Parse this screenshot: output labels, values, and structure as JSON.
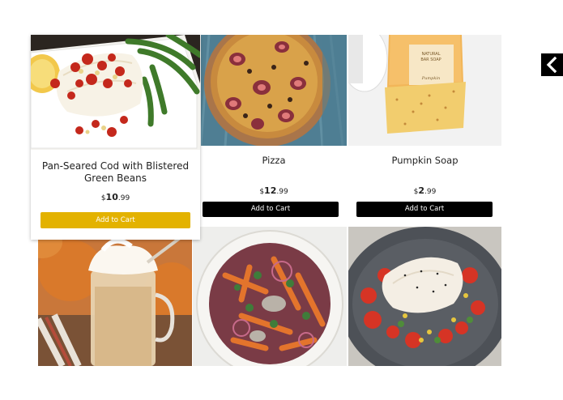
{
  "products": [
    {
      "name": "Pan-Seared Cod with Blistered Green Beans",
      "currency": "$",
      "price_whole": "10",
      "price_cents": ".99",
      "button": "Add to Cart"
    },
    {
      "name": "Pizza",
      "currency": "$",
      "price_whole": "12",
      "price_cents": ".99",
      "button": "Add to Cart"
    },
    {
      "name": "Pumpkin Soap",
      "currency": "$",
      "price_whole": "2",
      "price_cents": ".99",
      "button": "Add to Cart"
    }
  ],
  "images": {
    "cod": "pan-seared-cod-photo",
    "pizza": "fig-pizza-photo",
    "soap": "pumpkin-soap-photo",
    "latte": "pumpkin-latte-photo",
    "salad": "roasted-carrot-salad-photo",
    "fish": "fish-with-tomatoes-photo"
  },
  "soap_label": {
    "line1": "NATURAL",
    "line2": "BAR SOAP",
    "line3": "Pumpkin"
  },
  "colors": {
    "featured_button": "#e3b200",
    "button": "#000000",
    "button_text": "#ffffff"
  },
  "nav": {
    "arrow_icon": "chevron-left-icon"
  }
}
